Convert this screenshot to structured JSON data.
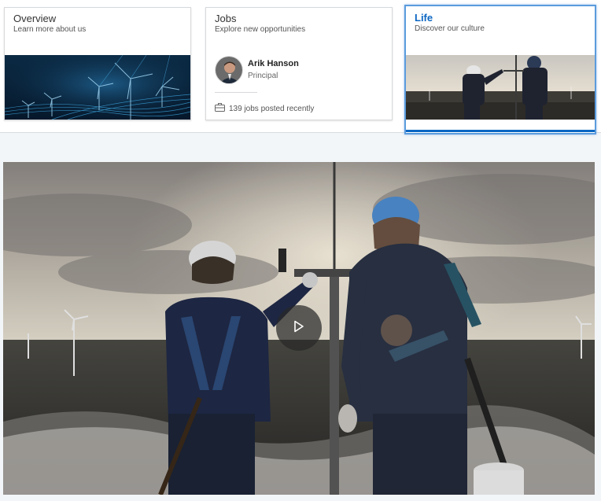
{
  "tabs": [
    {
      "title": "Overview",
      "subtitle": "Learn more about us"
    },
    {
      "title": "Jobs",
      "subtitle": "Explore new opportunities",
      "person": {
        "name": "Arik Hanson",
        "title": "Principal"
      },
      "jobs_text": "139 jobs posted recently"
    },
    {
      "title": "Life",
      "subtitle": "Discover our culture",
      "selected": true
    }
  ],
  "icons": {
    "briefcase": "briefcase-icon",
    "play": "play-icon"
  },
  "colors": {
    "accent": "#0b66c2",
    "selected_border": "#5b9bdd",
    "page_bg": "#f3f6f8"
  }
}
